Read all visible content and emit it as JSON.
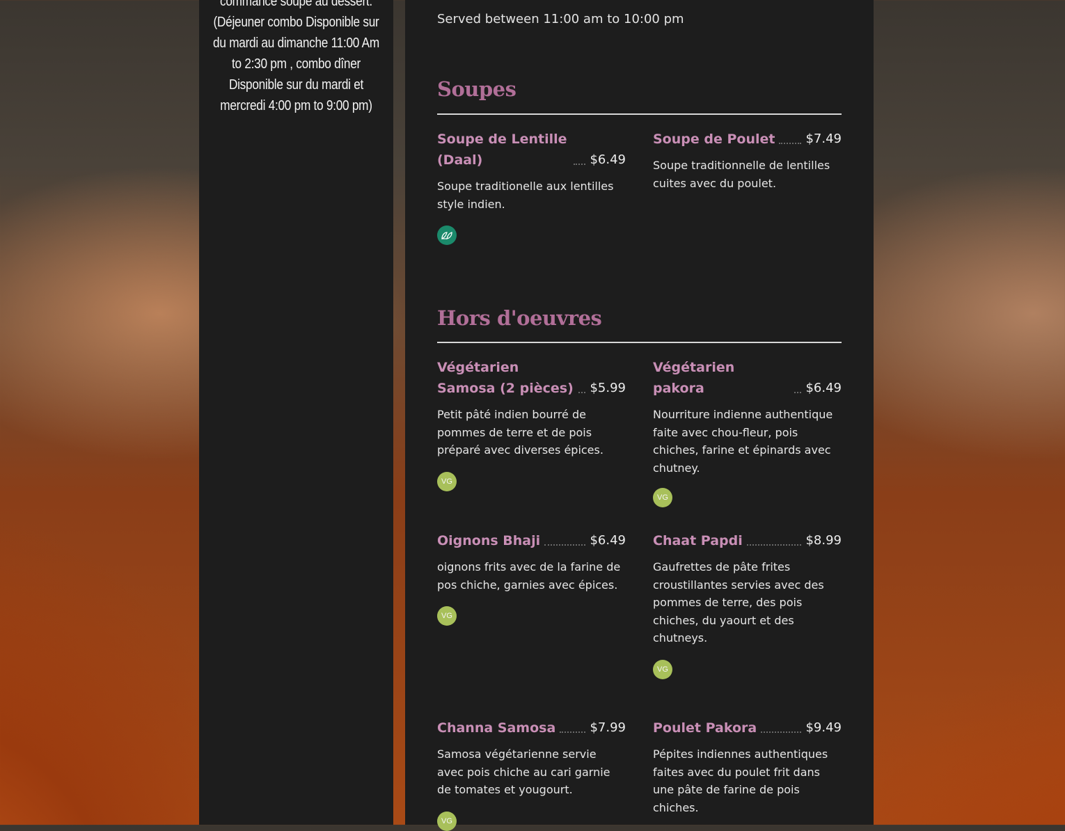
{
  "left_panel": {
    "text": "commance soupe au dessert. (Déjeuner combo Disponible sur du mardi au dimanche 11:00 Am to 2:30 pm , combo dîner Disponible sur du mardi et mercredi 4:00 pm to 9:00 pm)"
  },
  "menu": {
    "hours": "Served between 11:00 am to 10:00 pm",
    "sections": [
      {
        "title": "Soupes",
        "items": [
          {
            "name": "Soupe de Lentille (Daal)",
            "price": "$6.49",
            "description": "Soupe traditionelle aux lentilles style indien.",
            "badge": "vegan-leaf-icon"
          },
          {
            "name": "Soupe de Poulet",
            "price": "$7.49",
            "description": "Soupe traditionnelle de lentilles cuites avec du poulet.",
            "badge": ""
          }
        ]
      },
      {
        "title": "Hors d'oeuvres",
        "items": [
          {
            "name": "Végétarien Samosa (2 pièces)",
            "price": "$5.99",
            "description": "Petit pâté indien bourré de pommes de terre et de pois préparé avec diverses épices.",
            "badge": "VG"
          },
          {
            "name": "Végétarien pakora",
            "price": "$6.49",
            "description": "Nourriture indienne authentique faite avec chou-fleur, pois chiches, farine et épinards avec chutney.",
            "badge": "VG"
          },
          {
            "name": "Oignons Bhaji",
            "price": "$6.49",
            "description": "oignons frits avec de la farine de pos chiche, garnies avec épices.",
            "badge": "VG"
          },
          {
            "name": "Chaat Papdi",
            "price": "$8.99",
            "description": "Gaufrettes de pâte frites croustillantes servies avec des pommes de terre, des pois chiches, du yaourt et des chutneys.",
            "badge": "VG"
          },
          {
            "name": "Channa Samosa",
            "price": "$7.99",
            "description": "Samosa végétarienne servie avec pois chiche au cari garnie de tomates et yougourt.",
            "badge": "VG"
          },
          {
            "name": "Poulet Pakora",
            "price": "$9.49",
            "description": "Pépites indiennes authentiques faites avec du poulet frit dans une pâte de farine de pois chiches.",
            "badge": ""
          }
        ]
      }
    ]
  },
  "colors": {
    "panel_bg": "#1d1d1d",
    "section_title": "#b16f98",
    "item_name": "#c98fb6",
    "badge_vg": "#a8c05a",
    "badge_vegan": "#1b8a6b"
  }
}
